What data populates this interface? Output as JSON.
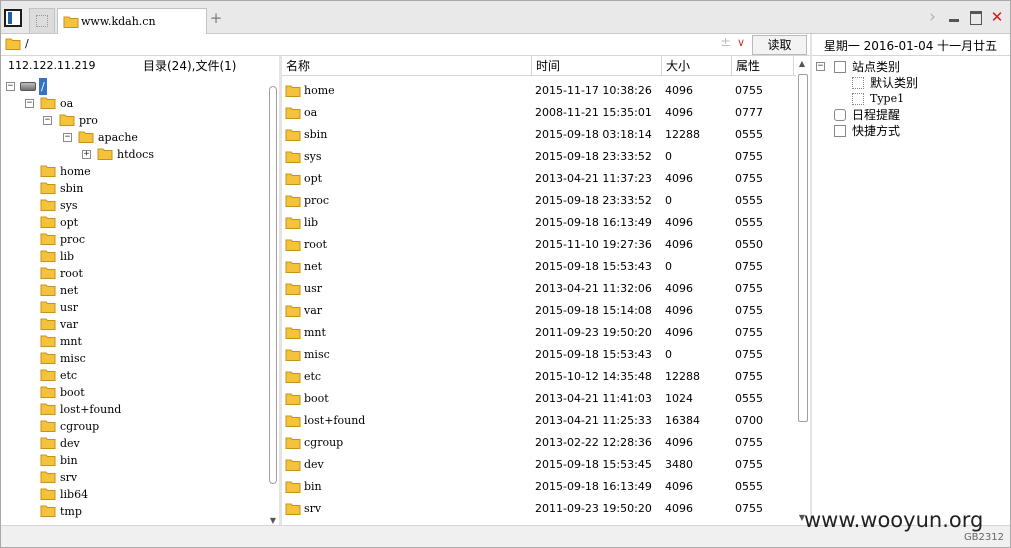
{
  "tabs": [
    {
      "label": ""
    },
    {
      "label": "www.kdah.cn"
    }
  ],
  "path": {
    "value": "/"
  },
  "read_button": "读取",
  "date_display": "星期一  2016-01-04  十一月廿五",
  "left": {
    "ip": "112.122.11.219",
    "summary": "目录(24),文件(1)",
    "tree": {
      "root": "/",
      "oa": "oa",
      "pro": "pro",
      "apache": "apache",
      "htdocs": "htdocs",
      "dirs": [
        "home",
        "sbin",
        "sys",
        "opt",
        "proc",
        "lib",
        "root",
        "net",
        "usr",
        "var",
        "mnt",
        "misc",
        "etc",
        "boot",
        "lost+found",
        "cgroup",
        "dev",
        "bin",
        "srv",
        "lib64",
        "tmp"
      ]
    }
  },
  "columns": {
    "name": "名称",
    "time": "时间",
    "size": "大小",
    "attr": "属性"
  },
  "files": [
    {
      "name": "home",
      "time": "2015-11-17 10:38:26",
      "size": "4096",
      "attr": "0755"
    },
    {
      "name": "oa",
      "time": "2008-11-21 15:35:01",
      "size": "4096",
      "attr": "0777"
    },
    {
      "name": "sbin",
      "time": "2015-09-18 03:18:14",
      "size": "12288",
      "attr": "0555"
    },
    {
      "name": "sys",
      "time": "2015-09-18 23:33:52",
      "size": "0",
      "attr": "0755"
    },
    {
      "name": "opt",
      "time": "2013-04-21 11:37:23",
      "size": "4096",
      "attr": "0755"
    },
    {
      "name": "proc",
      "time": "2015-09-18 23:33:52",
      "size": "0",
      "attr": "0555"
    },
    {
      "name": "lib",
      "time": "2015-09-18 16:13:49",
      "size": "4096",
      "attr": "0555"
    },
    {
      "name": "root",
      "time": "2015-11-10 19:27:36",
      "size": "4096",
      "attr": "0550"
    },
    {
      "name": "net",
      "time": "2015-09-18 15:53:43",
      "size": "0",
      "attr": "0755"
    },
    {
      "name": "usr",
      "time": "2013-04-21 11:32:06",
      "size": "4096",
      "attr": "0755"
    },
    {
      "name": "var",
      "time": "2015-09-18 15:14:08",
      "size": "4096",
      "attr": "0755"
    },
    {
      "name": "mnt",
      "time": "2011-09-23 19:50:20",
      "size": "4096",
      "attr": "0755"
    },
    {
      "name": "misc",
      "time": "2015-09-18 15:53:43",
      "size": "0",
      "attr": "0755"
    },
    {
      "name": "etc",
      "time": "2015-10-12 14:35:48",
      "size": "12288",
      "attr": "0755"
    },
    {
      "name": "boot",
      "time": "2013-04-21 11:41:03",
      "size": "1024",
      "attr": "0555"
    },
    {
      "name": "lost+found",
      "time": "2013-04-21 11:25:33",
      "size": "16384",
      "attr": "0700"
    },
    {
      "name": "cgroup",
      "time": "2013-02-22 12:28:36",
      "size": "4096",
      "attr": "0755"
    },
    {
      "name": "dev",
      "time": "2015-09-18 15:53:45",
      "size": "3480",
      "attr": "0755"
    },
    {
      "name": "bin",
      "time": "2015-09-18 16:13:49",
      "size": "4096",
      "attr": "0555"
    },
    {
      "name": "srv",
      "time": "2011-09-23 19:50:20",
      "size": "4096",
      "attr": "0755"
    }
  ],
  "right": {
    "site_category": "站点类别",
    "default_category": "默认类别",
    "type1": "Type1",
    "schedule": "日程提醒",
    "shortcuts": "快捷方式"
  },
  "status": {
    "encoding": "GB2312",
    "watermark": "www.wooyun.org"
  },
  "colors": {
    "folder": "#f4c23b",
    "folder_dark": "#c8921a",
    "selection": "#3573c8",
    "close": "#d21b1b"
  },
  "icons": [
    "folder-icon",
    "drive-icon",
    "plus-icon",
    "close-icon",
    "minimize-icon",
    "maximize-icon",
    "chevron-right-icon",
    "dropdown-icon",
    "calendar-icon",
    "shortcut-icon"
  ]
}
